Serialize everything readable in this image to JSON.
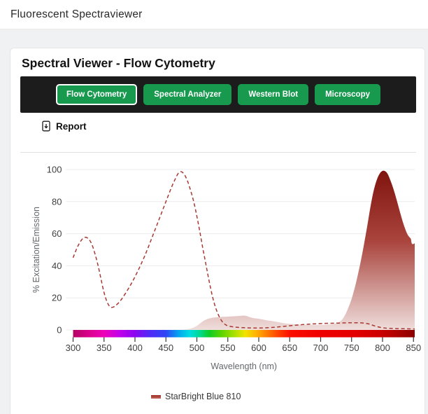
{
  "header": {
    "title": "Fluorescent Spectraviewer"
  },
  "card": {
    "title": "Spectral Viewer - Flow Cytometry",
    "tabs": [
      {
        "label": "Flow Cytometry",
        "active": true
      },
      {
        "label": "Spectral Analyzer",
        "active": false
      },
      {
        "label": "Western Blot",
        "active": false
      },
      {
        "label": "Microscopy",
        "active": false
      }
    ],
    "report_label": "Report"
  },
  "colors": {
    "accent_green": "#179a4e",
    "toolbar_bg": "#1c1c1c",
    "excitation_line": "#a83933",
    "emission_gradient_top": "#7f130d",
    "emission_gradient_mid": "#aa453e",
    "emission_gradient_bottom": "#efdedc",
    "grid_line": "#ececec",
    "tick_text": "#404040",
    "axis_title_text": "#65686c"
  },
  "chart_data": {
    "type": "area",
    "title": "",
    "xlabel": "Wavelength (nm)",
    "ylabel": "% Excitation/Emission",
    "xlim": [
      300,
      852
    ],
    "ylim": [
      0,
      100
    ],
    "x_ticks": [
      300,
      350,
      400,
      450,
      500,
      550,
      600,
      650,
      700,
      750,
      800,
      850
    ],
    "y_ticks": [
      0,
      20,
      40,
      60,
      80,
      100
    ],
    "grid": true,
    "legend_position": "bottom",
    "legend": [
      {
        "label": "StarBright Blue 810",
        "color": "#9c2f27"
      }
    ],
    "series": [
      {
        "name": "StarBright Blue 810 Excitation",
        "style": "dashed",
        "points": [
          [
            300,
            45
          ],
          [
            305,
            50
          ],
          [
            310,
            54
          ],
          [
            315,
            57
          ],
          [
            320,
            58
          ],
          [
            325,
            57
          ],
          [
            330,
            54
          ],
          [
            335,
            48
          ],
          [
            340,
            41
          ],
          [
            345,
            32
          ],
          [
            350,
            23
          ],
          [
            355,
            17
          ],
          [
            360,
            14
          ],
          [
            365,
            14
          ],
          [
            370,
            15.5
          ],
          [
            375,
            17.5
          ],
          [
            380,
            20
          ],
          [
            390,
            26
          ],
          [
            400,
            33
          ],
          [
            410,
            41
          ],
          [
            420,
            50
          ],
          [
            430,
            60
          ],
          [
            440,
            70
          ],
          [
            450,
            80
          ],
          [
            460,
            90
          ],
          [
            465,
            94
          ],
          [
            470,
            98
          ],
          [
            475,
            99
          ],
          [
            480,
            97
          ],
          [
            485,
            93
          ],
          [
            490,
            87
          ],
          [
            495,
            80
          ],
          [
            500,
            71
          ],
          [
            505,
            61
          ],
          [
            510,
            50
          ],
          [
            515,
            40
          ],
          [
            520,
            30
          ],
          [
            525,
            21
          ],
          [
            530,
            14
          ],
          [
            535,
            9
          ],
          [
            540,
            5.5
          ],
          [
            545,
            3.5
          ],
          [
            550,
            2.5
          ],
          [
            560,
            1.8
          ],
          [
            570,
            1.5
          ],
          [
            580,
            1.3
          ],
          [
            590,
            1.2
          ],
          [
            600,
            1.2
          ],
          [
            610,
            1.3
          ],
          [
            620,
            1.5
          ],
          [
            630,
            1.8
          ],
          [
            640,
            2.2
          ],
          [
            650,
            2.6
          ],
          [
            660,
            3
          ],
          [
            670,
            3.3
          ],
          [
            680,
            3.6
          ],
          [
            690,
            3.8
          ],
          [
            700,
            4
          ],
          [
            710,
            4.1
          ],
          [
            720,
            4.2
          ],
          [
            730,
            4.3
          ],
          [
            740,
            4.4
          ],
          [
            750,
            4.5
          ],
          [
            760,
            4.5
          ],
          [
            770,
            4.3
          ],
          [
            775,
            4
          ],
          [
            780,
            3.5
          ],
          [
            785,
            2.8
          ],
          [
            790,
            2.2
          ],
          [
            795,
            1.7
          ],
          [
            800,
            1.3
          ],
          [
            810,
            1
          ],
          [
            820,
            0.9
          ],
          [
            830,
            0.8
          ],
          [
            840,
            0.7
          ],
          [
            850,
            0.6
          ],
          [
            852,
            0.6
          ]
        ]
      },
      {
        "name": "StarBright Blue 810 Emission",
        "style": "filled",
        "points": [
          [
            300,
            0
          ],
          [
            470,
            0
          ],
          [
            480,
            0.2
          ],
          [
            490,
            0.8
          ],
          [
            495,
            1.5
          ],
          [
            500,
            2.5
          ],
          [
            505,
            4
          ],
          [
            510,
            5.5
          ],
          [
            515,
            6.5
          ],
          [
            520,
            7.2
          ],
          [
            525,
            7.6
          ],
          [
            530,
            7.8
          ],
          [
            535,
            8
          ],
          [
            540,
            8.1
          ],
          [
            545,
            8.2
          ],
          [
            550,
            8.3
          ],
          [
            555,
            8.4
          ],
          [
            560,
            8.5
          ],
          [
            565,
            8.6
          ],
          [
            570,
            8.8
          ],
          [
            575,
            9
          ],
          [
            580,
            8.8
          ],
          [
            585,
            8
          ],
          [
            590,
            7.5
          ],
          [
            595,
            7.2
          ],
          [
            600,
            7
          ],
          [
            605,
            6.6
          ],
          [
            610,
            6.2
          ],
          [
            615,
            5.8
          ],
          [
            620,
            5.6
          ],
          [
            625,
            5.3
          ],
          [
            630,
            5
          ],
          [
            635,
            4.6
          ],
          [
            640,
            4.2
          ],
          [
            645,
            4
          ],
          [
            650,
            3.8
          ],
          [
            660,
            3.5
          ],
          [
            670,
            3.3
          ],
          [
            680,
            3.2
          ],
          [
            690,
            3.2
          ],
          [
            700,
            3.2
          ],
          [
            710,
            3.3
          ],
          [
            715,
            3.4
          ],
          [
            720,
            3.6
          ],
          [
            725,
            4
          ],
          [
            730,
            4.8
          ],
          [
            735,
            6.5
          ],
          [
            740,
            9.5
          ],
          [
            745,
            14
          ],
          [
            750,
            19
          ],
          [
            755,
            26
          ],
          [
            760,
            34
          ],
          [
            765,
            43
          ],
          [
            770,
            53
          ],
          [
            775,
            64
          ],
          [
            780,
            76
          ],
          [
            785,
            86
          ],
          [
            790,
            93
          ],
          [
            795,
            97.5
          ],
          [
            800,
            99.5
          ],
          [
            805,
            99
          ],
          [
            808,
            97.5
          ],
          [
            810,
            96
          ],
          [
            815,
            91
          ],
          [
            820,
            85
          ],
          [
            825,
            78
          ],
          [
            830,
            71
          ],
          [
            835,
            64.5
          ],
          [
            840,
            59.5
          ],
          [
            844,
            57.5
          ],
          [
            846,
            57
          ],
          [
            847,
            53.5
          ],
          [
            850,
            53.5
          ],
          [
            852,
            54
          ]
        ]
      }
    ],
    "spectrum_strip": {
      "stops": [
        {
          "offset": 0.0,
          "color": "#b30563"
        },
        {
          "offset": 0.0453,
          "color": "#d9008c"
        },
        {
          "offset": 0.0906,
          "color": "#ee00b8"
        },
        {
          "offset": 0.1359,
          "color": "#c100ea"
        },
        {
          "offset": 0.1812,
          "color": "#8a06f0"
        },
        {
          "offset": 0.2264,
          "color": "#4f2bf7"
        },
        {
          "offset": 0.2717,
          "color": "#2e46f5"
        },
        {
          "offset": 0.308,
          "color": "#05a3f0"
        },
        {
          "offset": 0.3406,
          "color": "#00dce2"
        },
        {
          "offset": 0.3714,
          "color": "#00d88f"
        },
        {
          "offset": 0.3986,
          "color": "#0ccc25"
        },
        {
          "offset": 0.4348,
          "color": "#5ed400"
        },
        {
          "offset": 0.471,
          "color": "#a8e000"
        },
        {
          "offset": 0.5036,
          "color": "#f0e400"
        },
        {
          "offset": 0.5344,
          "color": "#ffb400"
        },
        {
          "offset": 0.5652,
          "color": "#ff8000"
        },
        {
          "offset": 0.6014,
          "color": "#ff4000"
        },
        {
          "offset": 0.6377,
          "color": "#fa0c00"
        },
        {
          "offset": 0.7246,
          "color": "#ef0000"
        },
        {
          "offset": 0.8243,
          "color": "#e30000"
        },
        {
          "offset": 0.8967,
          "color": "#cd0000"
        },
        {
          "offset": 0.9511,
          "color": "#ac0101"
        },
        {
          "offset": 1.0,
          "color": "#8c0000"
        }
      ]
    }
  }
}
